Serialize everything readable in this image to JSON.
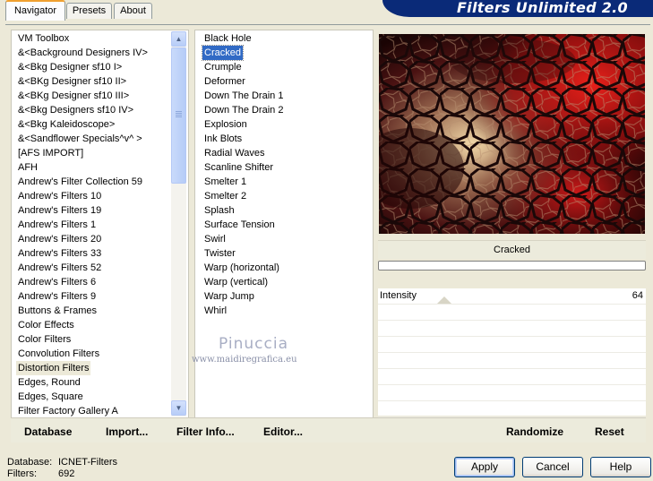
{
  "app": {
    "title": "Filters Unlimited 2.0"
  },
  "tabs": [
    {
      "label": "Navigator",
      "active": true
    },
    {
      "label": "Presets",
      "active": false
    },
    {
      "label": "About",
      "active": false
    }
  ],
  "categories": [
    "VM Toolbox",
    "&<Background Designers IV>",
    "&<Bkg Designer sf10 I>",
    "&<BKg Designer sf10 II>",
    "&<BKg Designer sf10 III>",
    "&<Bkg Designers sf10 IV>",
    "&<Bkg Kaleidoscope>",
    "&<Sandflower Specials^v^ >",
    "[AFS IMPORT]",
    "AFH",
    "Andrew's Filter Collection 59",
    "Andrew's Filters 10",
    "Andrew's Filters 19",
    "Andrew's Filters 1",
    "Andrew's Filters 20",
    "Andrew's Filters 33",
    "Andrew's Filters 52",
    "Andrew's Filters 6",
    "Andrew's Filters 9",
    "Buttons & Frames",
    "Color Effects",
    "Color Filters",
    "Convolution Filters",
    "Distortion Filters",
    "Edges, Round",
    "Edges, Square",
    "Filter Factory Gallery A"
  ],
  "selected_category": "Distortion Filters",
  "filters": [
    "Black Hole",
    "Cracked",
    "Crumple",
    "Deformer",
    "Down The Drain 1",
    "Down The Drain 2",
    "Explosion",
    "Ink Blots",
    "Radial Waves",
    "Scanline Shifter",
    "Smelter 1",
    "Smelter 2",
    "Splash",
    "Surface Tension",
    "Swirl",
    "Twister",
    "Warp (horizontal)",
    "Warp (vertical)",
    "Warp Jump",
    "Whirl"
  ],
  "selected_filter": "Cracked",
  "watermark": {
    "name": "Pinuccia",
    "url": "www.maidiregrafica.eu"
  },
  "preview": {
    "filter_name": "Cracked",
    "progress": 0
  },
  "parameters": [
    {
      "label": "Intensity",
      "value": "64"
    }
  ],
  "buttons": {
    "database": "Database",
    "import": "Import...",
    "filter_info": "Filter Info...",
    "editor": "Editor...",
    "randomize": "Randomize",
    "reset": "Reset",
    "apply": "Apply",
    "cancel": "Cancel",
    "help": "Help"
  },
  "status": {
    "database_label": "Database:",
    "database_value": "ICNET-Filters",
    "filters_label": "Filters:",
    "filters_value": "692"
  },
  "colors": {
    "banner": "#0a2a78",
    "selection": "#316ac5",
    "window_bg": "#ece9d8"
  },
  "icons": {
    "scroll_up": "chevron-up-icon",
    "scroll_down": "chevron-down-icon"
  }
}
